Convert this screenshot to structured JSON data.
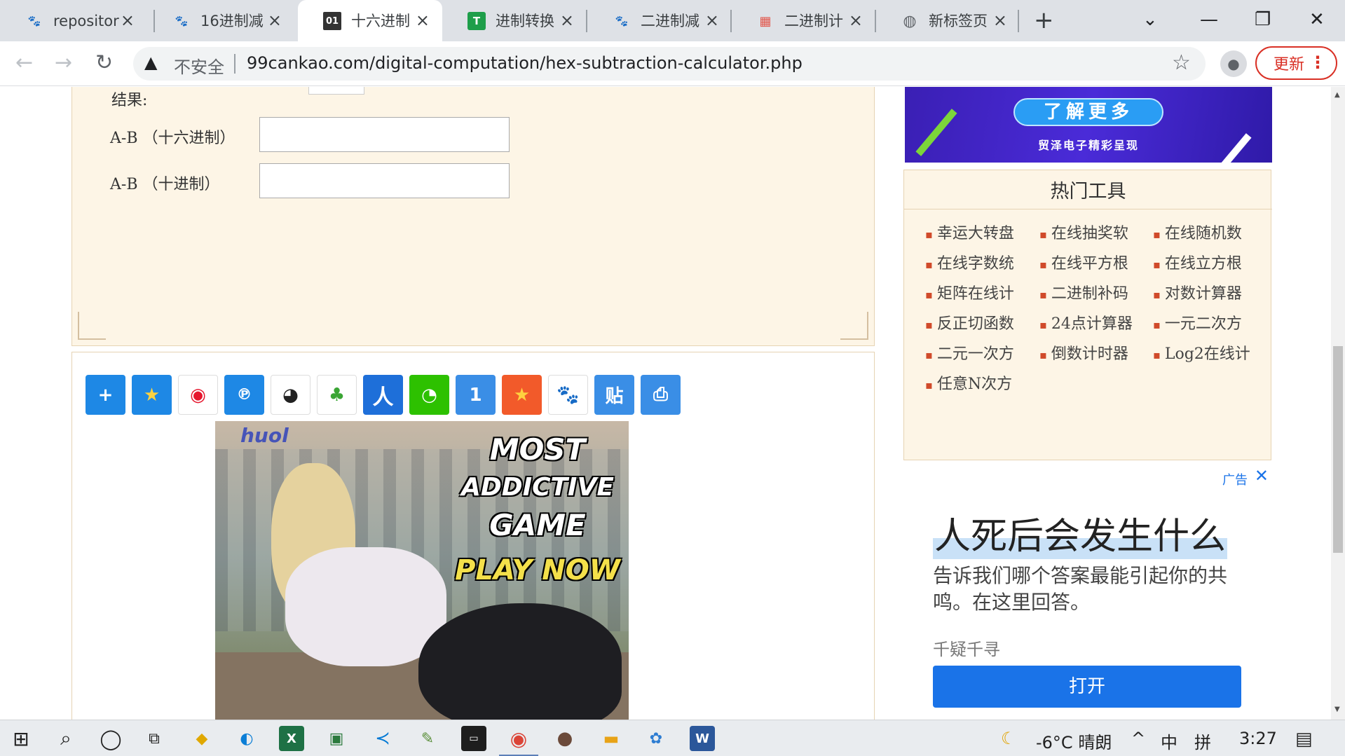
{
  "browser": {
    "tabs": [
      {
        "title": "repositor",
        "icon": "baidu-paw-icon"
      },
      {
        "title": "16进制减",
        "icon": "baidu-paw-icon"
      },
      {
        "title": "十六进制",
        "icon": "zero-one-icon",
        "active": true
      },
      {
        "title": "进制转换",
        "icon": "green-t-icon"
      },
      {
        "title": "二进制减",
        "icon": "baidu-paw-icon"
      },
      {
        "title": "二进制计",
        "icon": "grid-app-icon"
      },
      {
        "title": "新标签页",
        "icon": "globe-icon"
      }
    ],
    "security_label": "不安全",
    "url": "99cankao.com/digital-computation/hex-subtraction-calculator.php",
    "update_label": "更新"
  },
  "calculator": {
    "result_label": "结果:",
    "rows": [
      {
        "label": "A-B （十六进制）",
        "value": ""
      },
      {
        "label": "A-B （十进制）",
        "value": ""
      }
    ]
  },
  "share_icons": [
    "plus-share-icon",
    "qzone-star-icon",
    "weibo-icon",
    "tqq-icon",
    "qq-penguin-icon",
    "clover-icon",
    "renren-icon",
    "wechat-icon",
    "one-icon",
    "star-face-icon",
    "baidu-paw-icon",
    "tieba-icon",
    "print-icon"
  ],
  "left_ad": {
    "brand": "huol",
    "headline": [
      "MOST",
      "ADDICTIVE",
      "GAME"
    ],
    "cta": "PLAY NOW"
  },
  "sidebar": {
    "banner": {
      "button": "了解更多",
      "subtitle": "贸泽电子精彩呈现"
    },
    "hot_tools": {
      "title": "热门工具",
      "items": [
        "幸运大转盘",
        "在线抽奖软",
        "在线随机数",
        "在线字数统",
        "在线平方根",
        "在线立方根",
        "矩阵在线计",
        "二进制补码",
        "对数计算器",
        "反正切函数",
        "24点计算器",
        "一元二次方",
        "二元一次方",
        "倒数计时器",
        "Log2在线计",
        "任意N次方"
      ]
    },
    "ad": {
      "tag": "广告",
      "headline": "人死后会发生什么",
      "body": "告诉我们哪个答案最能引起你的共鸣。在这里回答。",
      "source": "千疑千寻",
      "button": "打开"
    }
  },
  "taskbar": {
    "weather": "-6°C 晴朗",
    "ime": "中",
    "ime_mode": "拼",
    "time": "3:27"
  }
}
